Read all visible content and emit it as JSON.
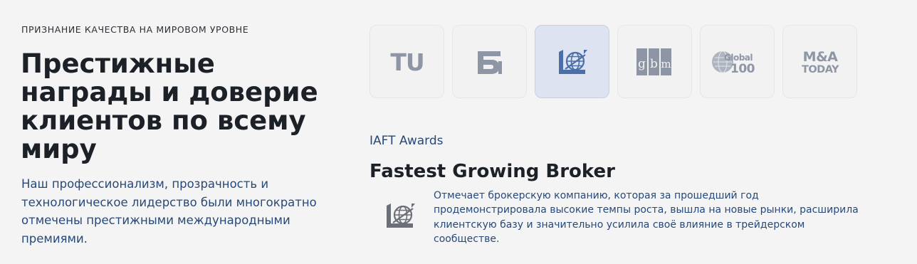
{
  "eyebrow": "ПРИЗНАНИЕ КАЧЕСТВА НА МИРОВОМ УРОВНЕ",
  "headline": "Престижные награды и доверие клиентов по всему миру",
  "lead": "Наш профессионализм, прозрачность и технологическое лидерство были многократно отмечены престижными международными премиями.",
  "logos": [
    {
      "icon": "tu-logo-icon",
      "text": "TU",
      "active": false
    },
    {
      "icon": "fi-logo-icon",
      "text": "",
      "active": false
    },
    {
      "icon": "iaft-globe-logo-icon",
      "text": "",
      "active": true
    },
    {
      "icon": "gbm-logo-icon",
      "text": "",
      "active": false
    },
    {
      "icon": "global100-logo-icon",
      "text": "Global 100",
      "line1": "Global",
      "line2": "100",
      "active": false
    },
    {
      "icon": "ma-today-logo-icon",
      "text": "M&A TODAY",
      "line1": "M&A",
      "line2": "TODAY",
      "active": false
    }
  ],
  "award": {
    "organization": "IAFT Awards",
    "title": "Fastest Growing Broker",
    "description": "Отмечает брокерскую компанию, которая за прошедший год продемонстрировала высокие темпы роста, вышла на новые рынки, расширила клиентскую базу и значительно усилила своё влияние в трейдерском сообществе."
  },
  "colors": {
    "background": "#f4f4f4",
    "heading": "#1c2027",
    "body_text": "#27497a",
    "logo_gray": "#8e96a6",
    "logo_active_blue": "#4a6fa8",
    "active_tile": "#dde3f0"
  }
}
